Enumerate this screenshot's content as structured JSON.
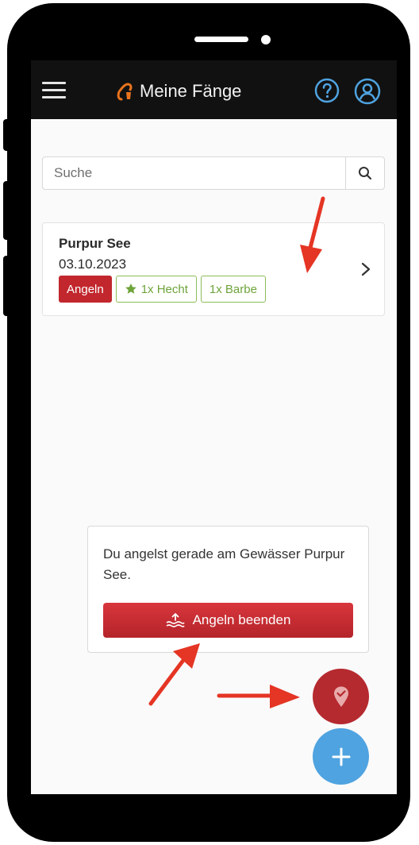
{
  "header": {
    "title": "Meine Fänge",
    "icons": [
      "menu-icon",
      "hook-icon",
      "help-icon",
      "user-icon"
    ]
  },
  "search": {
    "placeholder": "Suche",
    "value": ""
  },
  "catches": [
    {
      "water": "Purpur See",
      "date": "03.10.2023",
      "status_tag": "Angeln",
      "fish_tags": [
        "1x Hecht",
        "1x Barbe"
      ]
    }
  ],
  "session": {
    "message": "Du angelst gerade am Gewässer Purpur See.",
    "end_button": "Angeln beenden"
  },
  "colors": {
    "appbar": "#111111",
    "accent_orange": "#e8731e",
    "accent_blue": "#4fa3e0",
    "red": "#c1272d",
    "green": "#6ea43a",
    "annotation_arrow": "#e53524"
  }
}
